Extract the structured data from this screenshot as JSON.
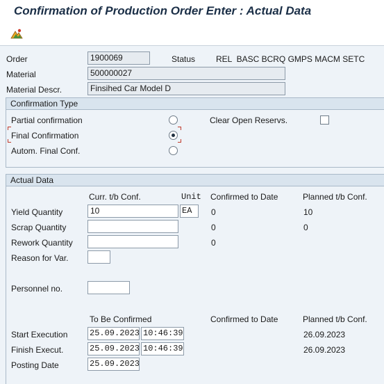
{
  "title": "Confirmation of Production Order Enter : Actual Data",
  "toolbar": {
    "execute_icon": "mountain-execute-icon"
  },
  "header": {
    "order_label": "Order",
    "order_value": "1900069",
    "status_label": "Status",
    "status_value": "REL  BASC BCRQ GMPS MACM SETC",
    "material_label": "Material",
    "material_value": "500000027",
    "material_descr_label": "Material Descr.",
    "material_descr_value": "Finsihed Car Model D"
  },
  "confirmation_type": {
    "title": "Confirmation Type",
    "partial_label": "Partial confirmation",
    "final_label": "Final Confirmation",
    "autom_label": "Autom. Final Conf.",
    "clear_reservs_label": "Clear Open Reservs.",
    "selected": "final"
  },
  "actual_data": {
    "title": "Actual Data",
    "col_curr": "Curr. t/b Conf.",
    "col_unit": "Unit",
    "col_confirmed": "Confirmed to Date",
    "col_planned": "Planned t/b Conf.",
    "rows": [
      {
        "label": "Yield Quantity",
        "curr": "10",
        "unit": "EA",
        "confirmed": "0",
        "planned": "10"
      },
      {
        "label": "Scrap Quantity",
        "curr": "",
        "confirmed": "0",
        "planned": "0"
      },
      {
        "label": "Rework Quantity",
        "curr": "",
        "confirmed": "0",
        "planned": ""
      }
    ],
    "reason_label": "Reason for Var.",
    "reason_value": "",
    "personnel_label": "Personnel no.",
    "personnel_value": "",
    "dates_col_to_be": "To Be Confirmed",
    "dates_col_confirmed": "Confirmed to Date",
    "dates_col_planned": "Planned t/b Conf.",
    "start_label": "Start Execution",
    "start_date": "25.09.2023",
    "start_time": "10:46:39",
    "start_planned": "26.09.2023",
    "finish_label": "Finish Execut.",
    "finish_date": "25.09.2023",
    "finish_time": "10:46:39",
    "finish_planned": "26.09.2023",
    "posting_label": "Posting Date",
    "posting_date": "25.09.2023"
  }
}
